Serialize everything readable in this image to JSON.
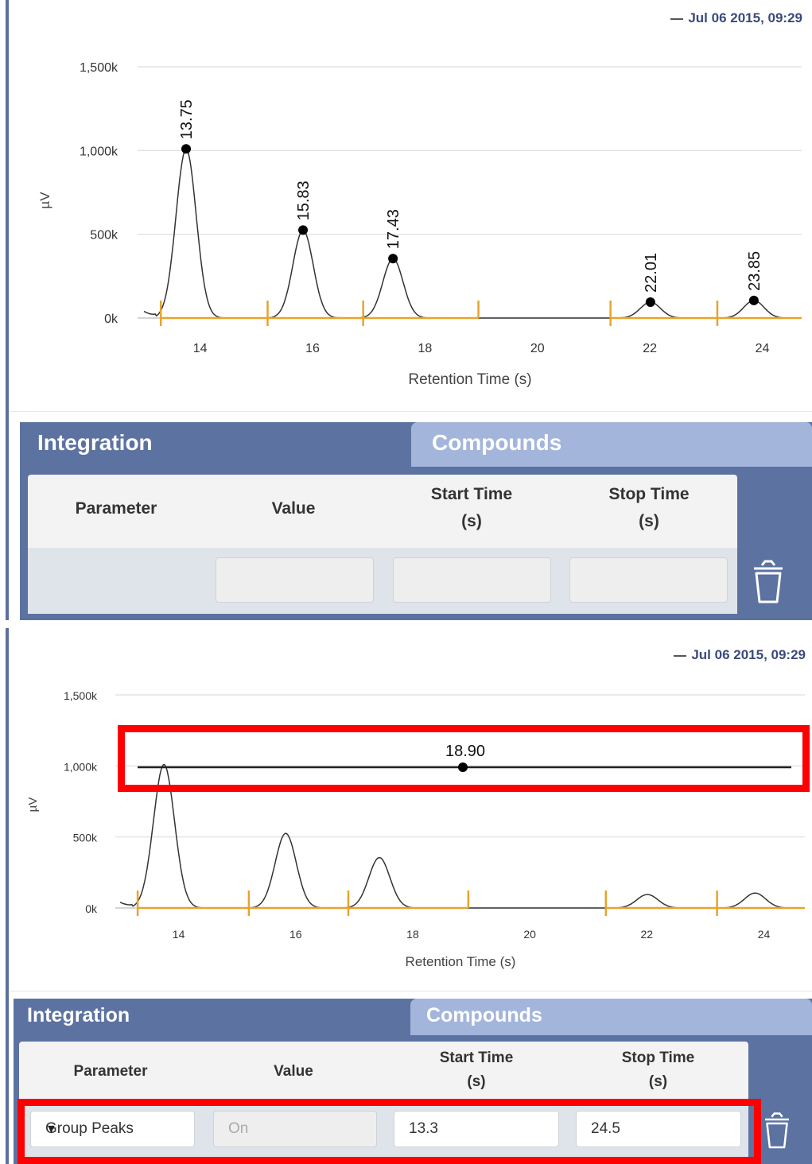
{
  "colors": {
    "tab_active": "#5c72a0",
    "tab_inactive": "#a3b5db",
    "baseline": "#e8a32c",
    "trace": "#333333",
    "highlight": "#ff0000",
    "legend": "#3a4a7a"
  },
  "legend_label": "Jul 06 2015, 09:29",
  "chart_data": [
    {
      "type": "line",
      "title": "",
      "xlabel": "Retention Time (s)",
      "ylabel": "µV",
      "xlim": [
        13,
        24.7
      ],
      "ylim": [
        -20,
        1500
      ],
      "x_ticks": [
        "14",
        "16",
        "18",
        "20",
        "22",
        "24"
      ],
      "y_ticks": [
        "0k",
        "500k",
        "1,000k",
        "1,500k"
      ],
      "grid": true,
      "legend": "top-right",
      "peaks": [
        {
          "rt": 13.75,
          "height": 1010,
          "label": "13.75"
        },
        {
          "rt": 15.83,
          "height": 525,
          "label": "15.83"
        },
        {
          "rt": 17.43,
          "height": 355,
          "label": "17.43"
        },
        {
          "rt": 22.01,
          "height": 95,
          "label": "22.01"
        },
        {
          "rt": 23.85,
          "height": 105,
          "label": "23.85"
        }
      ],
      "baseline_segments": [
        [
          13.3,
          15.2
        ],
        [
          15.2,
          16.9
        ],
        [
          16.9,
          18.95
        ],
        [
          21.3,
          23.2
        ],
        [
          23.2,
          24.7
        ]
      ]
    },
    {
      "type": "line",
      "title": "",
      "xlabel": "Retention Time (s)",
      "ylabel": "µV",
      "xlim": [
        13,
        24.7
      ],
      "ylim": [
        -20,
        1500
      ],
      "x_ticks": [
        "14",
        "16",
        "18",
        "20",
        "22",
        "24"
      ],
      "y_ticks": [
        "0k",
        "500k",
        "1,000k",
        "1,500k"
      ],
      "grid": true,
      "legend": "top-right",
      "peaks": [
        {
          "rt": 13.75,
          "height": 1010
        },
        {
          "rt": 15.83,
          "height": 525
        },
        {
          "rt": 17.43,
          "height": 355
        },
        {
          "rt": 22.01,
          "height": 95
        },
        {
          "rt": 23.85,
          "height": 105
        }
      ],
      "baseline_segments": [
        [
          13.3,
          15.2
        ],
        [
          15.2,
          16.9
        ],
        [
          16.9,
          18.95
        ],
        [
          21.3,
          23.2
        ],
        [
          23.2,
          24.7
        ]
      ],
      "group_line": {
        "x_start": 13.3,
        "x_end": 24.5,
        "y": 1010,
        "marker_x": 18.9,
        "label": "18.90"
      }
    }
  ],
  "tabs": {
    "integration": "Integration",
    "compounds": "Compounds"
  },
  "table": {
    "headers": {
      "parameter": "Parameter",
      "value": "Value",
      "start_line1": "Start Time",
      "start_line2": "(s)",
      "stop_line1": "Stop Time",
      "stop_line2": "(s)"
    }
  },
  "row_top": {
    "parameter": "",
    "value": "",
    "start": "",
    "stop": ""
  },
  "row_bottom": {
    "parameter": "Group Peaks",
    "value": "On",
    "start": "13.3",
    "stop": "24.5"
  }
}
